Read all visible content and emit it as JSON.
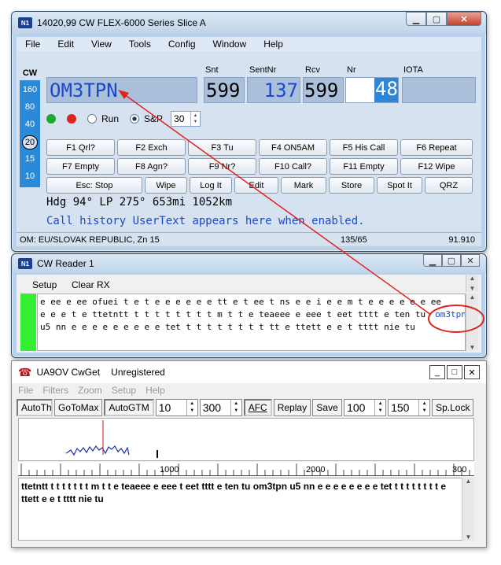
{
  "main": {
    "title": "14020,99 CW FLEX-6000 Series Slice A",
    "icon_text": "N1",
    "menu": [
      "File",
      "Edit",
      "View",
      "Tools",
      "Config",
      "Window",
      "Help"
    ],
    "mode": "CW",
    "bands": [
      "160",
      "80",
      "40",
      "20",
      "15",
      "10"
    ],
    "active_band": "20",
    "fields": {
      "snt_label": "Snt",
      "sentnr_label": "SentNr",
      "rcv_label": "Rcv",
      "nr_label": "Nr",
      "iota_label": "IOTA",
      "call": "OM3TPN",
      "snt": "599",
      "sentnr": "137",
      "rcv": "599",
      "nr": "48",
      "iota": ""
    },
    "run_label": "Run",
    "sp_label": "S&P",
    "spin_value": "30",
    "fkeys_row1": [
      "F1 Qrl?",
      "F2 Exch",
      "F3 Tu",
      "F4 ON5AM",
      "F5 His Call",
      "F6 Repeat"
    ],
    "fkeys_row2": [
      "F7 Empty",
      "F8 Agn?",
      "F9 Nr?",
      "F10 Call?",
      "F11 Empty",
      "F12 Wipe"
    ],
    "buttons_row3": [
      "Esc: Stop",
      "Wipe",
      "Log It",
      "Edit",
      "Mark",
      "Store",
      "Spot It",
      "QRZ"
    ],
    "heading_line": "Hdg 94° LP 275° 653mi 1052km",
    "history_line": "Call history UserText appears here when enabled.",
    "status_country": "OM: EU/SLOVAK REPUBLIC, Zn 15",
    "status_count": "135/65",
    "status_value": "91.910"
  },
  "reader": {
    "title": "CW Reader 1",
    "setup_label": "Setup",
    "clear_label": "Clear RX",
    "line1": " e  ee e ee ofuei t e t e e e e e e tt e t ee t  ns e e i e e m t e e e e e e ee",
    "line2": "e e e t e ttetntt t t t t t t t t m t t e teaeee e eee t eet tttt e ten tu",
    "line2_call": "om3tpn",
    "line3": "u5 nn e e e e e e e e e tet t t t t t t t t tt e ttett e e t tttt nie tu"
  },
  "cwget": {
    "title": "UA9OV CwGet",
    "status": "Unregistered",
    "menu": [
      "File",
      "Filters",
      "Zoom",
      "Setup",
      "Help"
    ],
    "autothr_label": "AutoThr",
    "gotomax_label": "GoToMax",
    "autogtm_label": "AutoGTM",
    "val1": "10",
    "val2": "300",
    "afc_label": "AFC",
    "replay_label": "Replay",
    "save_label": "Save",
    "val3": "100",
    "val4": "150",
    "splock_label": "Sp.Lock",
    "ruler_labels": [
      "1000",
      "2000",
      "300"
    ],
    "decoded_text": "ttetntt t t t t t t t m t t e teaeee e eee t eet tttt e ten tu om3tpn u5 nn e e e e e e e e tet t t t t t t t t e ttett e e t tttt nie tu"
  },
  "colors": {
    "call_blue": "#1a49c9",
    "annotation_red": "#e0231d",
    "band_blue": "#2a8ad7",
    "nr_highlight": "#2f86d8"
  }
}
